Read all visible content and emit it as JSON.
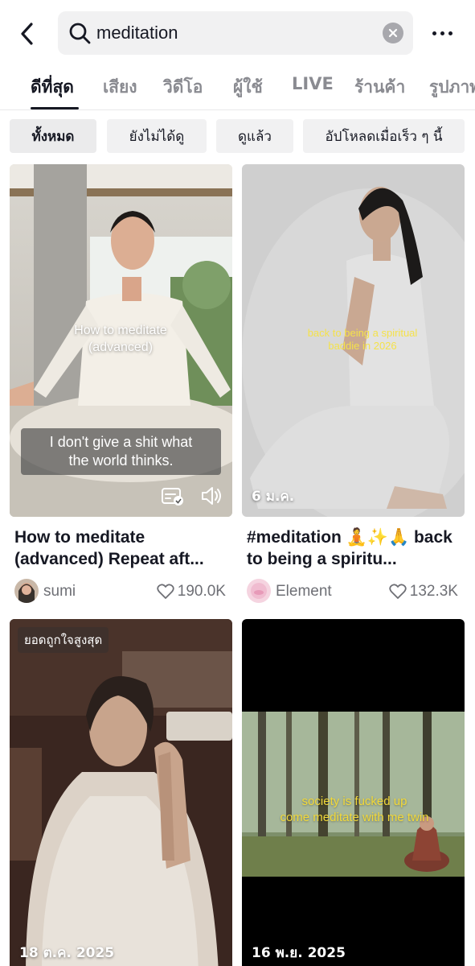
{
  "search": {
    "query": "meditation"
  },
  "tabs": [
    {
      "label": "ดีที่สุด",
      "active": true
    },
    {
      "label": "เสียง"
    },
    {
      "label": "วิดีโอ"
    },
    {
      "label": "ผู้ใช้"
    },
    {
      "label": "LIVE"
    },
    {
      "label": "ร้านค้า"
    },
    {
      "label": "รูปภาพ"
    }
  ],
  "filters": [
    {
      "label": "ทั้งหมด",
      "active": true
    },
    {
      "label": "ยังไม่ได้ดู"
    },
    {
      "label": "ดูแล้ว"
    },
    {
      "label": "อัปโหลดเมื่อเร็ว ๆ นี้"
    }
  ],
  "results": [
    {
      "overlay_title": "How to meditate\n(advanced)",
      "overlay_caption": "I don't give a shit what\nthe world thinks.",
      "title": "How to meditate (advanced) Repeat aft...",
      "author": "sumi",
      "likes": "190.0K"
    },
    {
      "overlay_title": "back to being a spiritual\nbaddie in 2026",
      "date": "6 ม.ค.",
      "title": "#meditation 🧘✨🙏 back to being a spiritu...",
      "author": "Element",
      "likes": "132.3K"
    },
    {
      "badge": "ยอดถูกใจสูงสุด",
      "date": "18 ต.ค. 2025"
    },
    {
      "overlay_title": "society is fucked up\ncome meditate with me twin",
      "date": "16 พ.ย. 2025"
    }
  ]
}
